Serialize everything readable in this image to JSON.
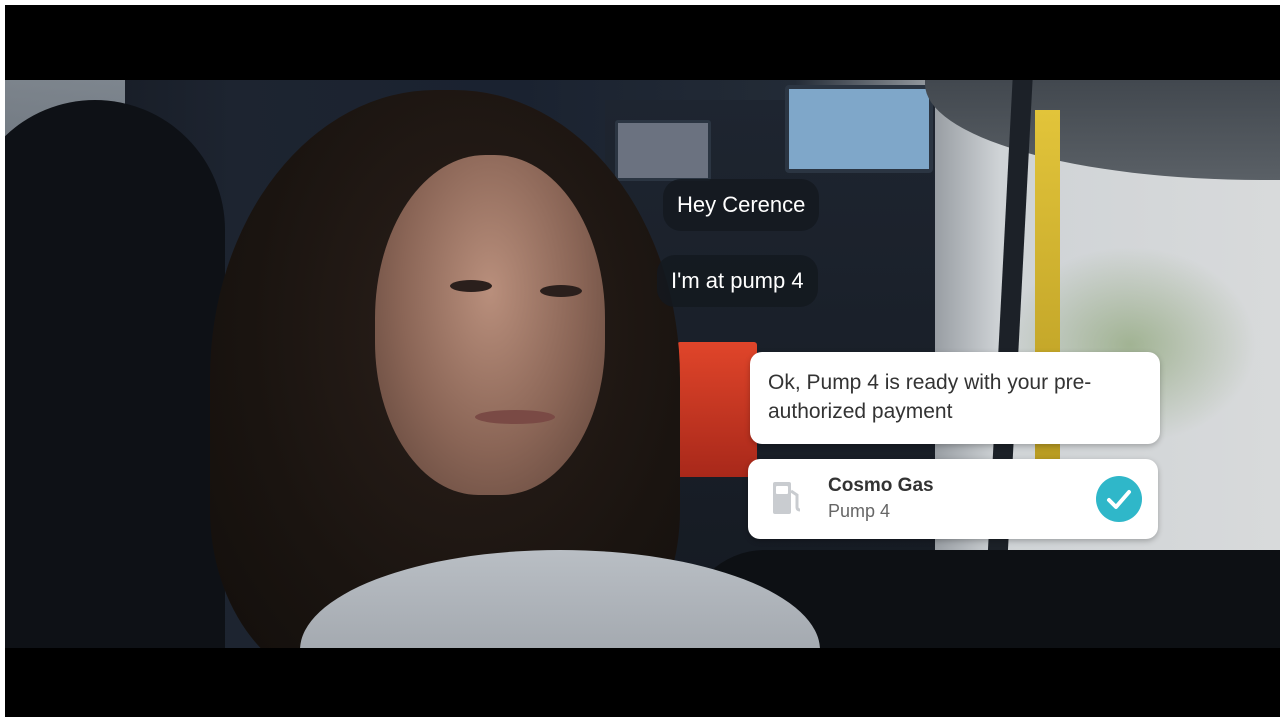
{
  "video": {
    "background_color": "#000000"
  },
  "conversation": {
    "user_messages": [
      "Hey Cerence",
      "I'm at pump 4"
    ],
    "assistant_reply": "Ok, Pump 4 is ready with your pre-authorized payment"
  },
  "station_card": {
    "name": "Cosmo Gas",
    "pump": "Pump 4",
    "icon": "fuel-pump-icon",
    "status_icon": "checkmark-icon",
    "status_color": "#2fb7c9"
  }
}
